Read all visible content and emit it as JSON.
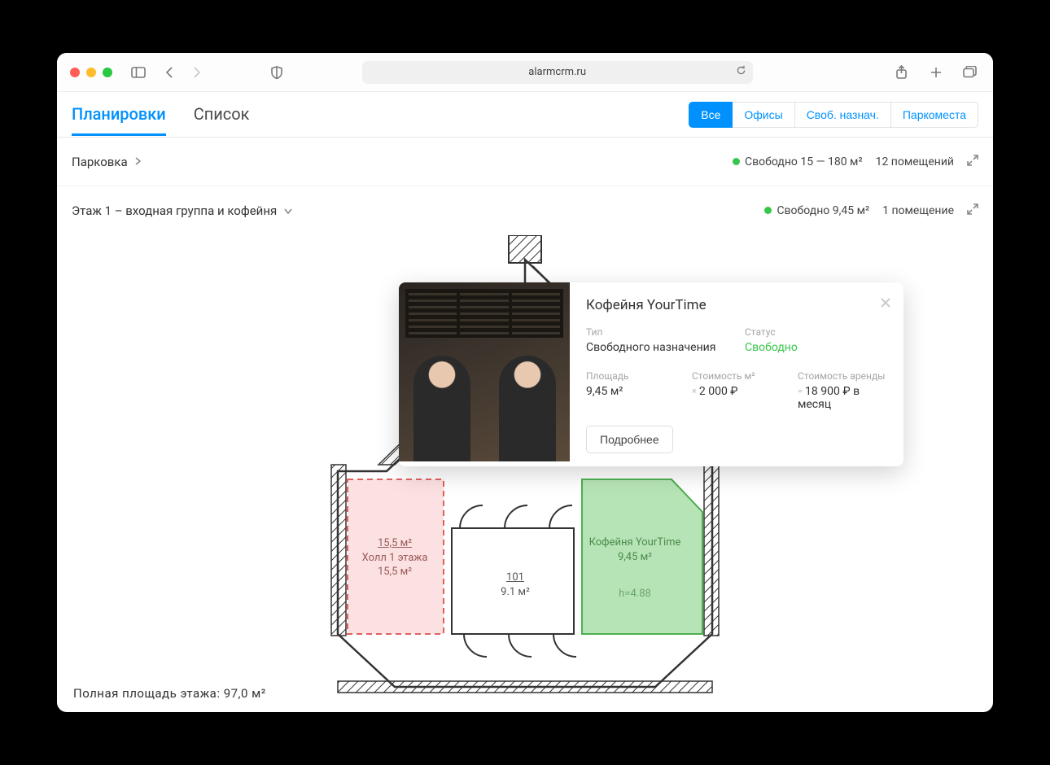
{
  "browser": {
    "url": "alarmcrm.ru"
  },
  "tabs": {
    "planirovki": "Планировки",
    "spisok": "Список"
  },
  "filters": {
    "all": "Все",
    "offices": "Офисы",
    "free_purpose": "Своб. назнач.",
    "parking": "Паркоместа"
  },
  "sections": {
    "parking": {
      "title": "Парковка",
      "free": "Свободно 15 — 180 м²",
      "count": "12 помещений"
    },
    "floor1": {
      "title": "Этаж 1 – входная группа и кофейня",
      "free": "Свободно 9,45 м²",
      "count": "1 помещение"
    }
  },
  "rooms": {
    "hall": {
      "top": "15,5 м²",
      "name": "Холл 1 этажа",
      "area": "15,5 м²"
    },
    "center": {
      "num": "101",
      "area": "9.1 м²"
    },
    "cafe": {
      "name": "Кофейня YourTime",
      "area": "9,45 м²",
      "height": "h=4.88"
    }
  },
  "popover": {
    "title": "Кофейня YourTime",
    "type_label": "Тип",
    "type_value": "Свободного назначения",
    "status_label": "Статус",
    "status_value": "Свободно",
    "area_label": "Площадь",
    "area_value": "9,45 м²",
    "price_m2_label": "Стоимость м²",
    "price_m2_value": "2 000 ₽",
    "rent_label": "Стоимость аренды",
    "rent_value": "18 900 ₽ в месяц",
    "details_btn": "Подробнее"
  },
  "footer": {
    "total_area": "Полная  площадь  этажа:   97,0  м²"
  }
}
